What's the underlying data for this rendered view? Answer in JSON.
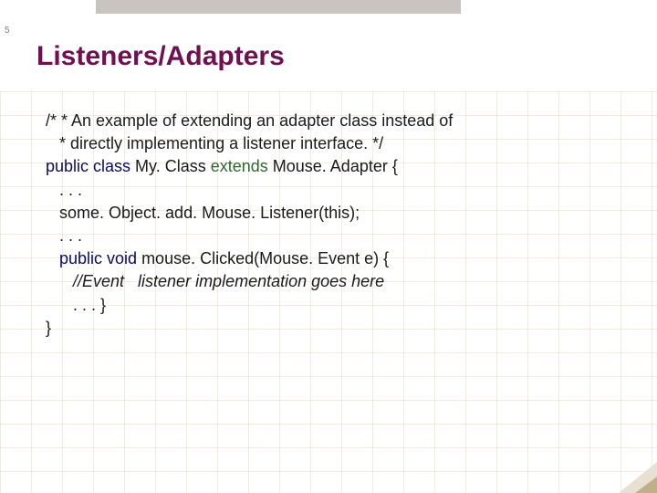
{
  "slide_number": "5",
  "title": "Listeners/Adapters",
  "code": {
    "l1": "/* * An example of extending an adapter class instead of",
    "l2": "   * directly implementing a listener interface. */",
    "l3a": "public class",
    "l3b": " My. Class ",
    "l3c": "extends",
    "l3d": " Mouse. Adapter {",
    "l4": "   . . .",
    "l5": "   some. Object. add. Mouse. Listener(this);",
    "l6": "   . . .",
    "l7a": "   public void",
    "l7b": " mouse. Clicked(Mouse. Event e) {",
    "l8": "      //Event   listener implementation goes here",
    "l9": "      . . . }",
    "l10": "}"
  }
}
